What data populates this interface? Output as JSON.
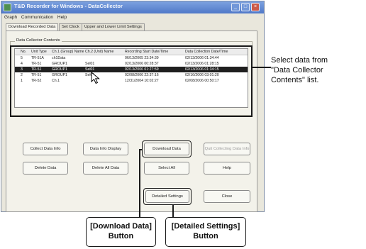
{
  "window": {
    "title": "T&D Recorder for Windows - DataCollector",
    "menu": [
      "Graph",
      "Communication",
      "Help"
    ]
  },
  "tabs": [
    "Download Recorded Data",
    "Set Clock",
    "Upper and Lower Limit Settings"
  ],
  "group_label": "Data Collector Contents",
  "list": {
    "columns": [
      "No.",
      "Unit Type",
      "Ch.1 (Group) Name",
      "Ch.2 (Unit) Name",
      "Recording Start Date/Time",
      "Data Collection Date/Time"
    ],
    "rows": [
      [
        "5",
        "TR-51A",
        "ch1Data",
        "",
        "06/13/2005 23:34:39",
        "02/13/2006 01:34:44"
      ],
      [
        "4",
        "TR-51",
        "GROUP1",
        "Sel01",
        "02/13/2006 00:28:37",
        "02/13/2006 01:28:15"
      ],
      [
        "3",
        "TR-51",
        "GROUP1",
        "Sel01",
        "02/13/2006 01:27:59",
        "02/13/2006 01:34:15"
      ],
      [
        "2",
        "TR-51",
        "GROUP1",
        "Sel01",
        "02/08/2006 22:37:16",
        "02/16/2006 03:01:20"
      ],
      [
        "1",
        "TR-52",
        "Ch.1",
        "",
        "12/31/2004 10:02:27",
        "02/08/2006 00:50:17"
      ]
    ],
    "selected_index": 2
  },
  "buttons": {
    "collect": "Collect Data Info",
    "display": "Data Info Display",
    "download": "Download Data",
    "quit": "Quit Collecting Data Info",
    "delete": "Delete Data",
    "delete_all": "Delete All Data",
    "select_all": "Select All",
    "help": "Help",
    "detailed": "Detailed Settings",
    "close": "Close"
  },
  "annotations": {
    "select_note": [
      "Select data from",
      "\"Data Collector",
      "Contents\" list."
    ],
    "download_label": [
      "[Download Data]",
      "Button"
    ],
    "detailed_label": [
      "[Detailed Settings]",
      "Button"
    ]
  }
}
